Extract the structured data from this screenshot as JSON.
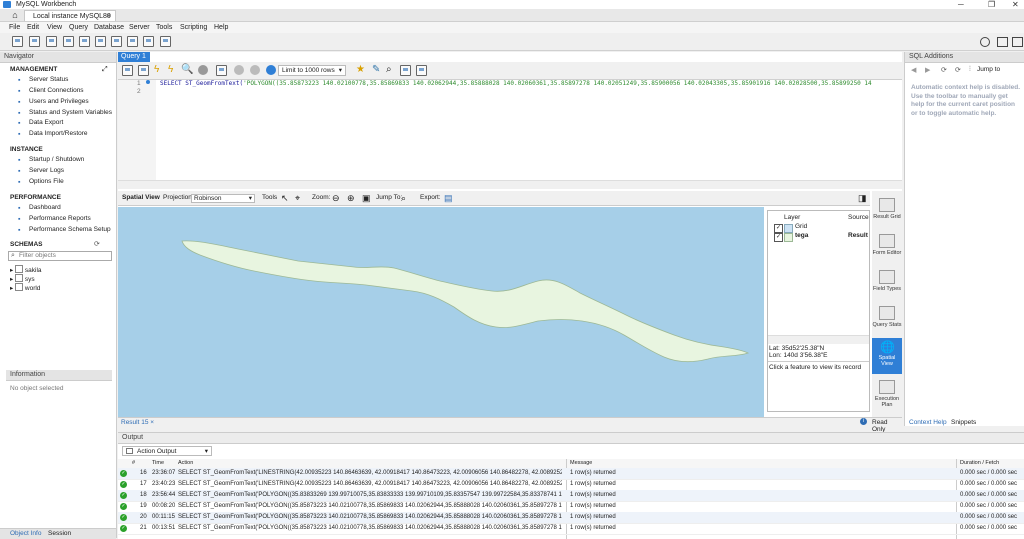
{
  "window": {
    "title": "MySQL Workbench",
    "connection_tab": "Local instance MySQL80"
  },
  "menu": [
    "File",
    "Edit",
    "View",
    "Query",
    "Database",
    "Server",
    "Tools",
    "Scripting",
    "Help"
  ],
  "navigator": {
    "header": "Navigator",
    "management": {
      "title": "MANAGEMENT",
      "items": [
        "Server Status",
        "Client Connections",
        "Users and Privileges",
        "Status and System Variables",
        "Data Export",
        "Data Import/Restore"
      ]
    },
    "instance": {
      "title": "INSTANCE",
      "items": [
        "Startup / Shutdown",
        "Server Logs",
        "Options File"
      ]
    },
    "performance": {
      "title": "PERFORMANCE",
      "items": [
        "Dashboard",
        "Performance Reports",
        "Performance Schema Setup"
      ]
    },
    "schemas": {
      "title": "SCHEMAS",
      "filter_placeholder": "Filter objects",
      "items": [
        "sakila",
        "sys",
        "world"
      ]
    }
  },
  "information": {
    "header": "Information",
    "empty": "No object selected"
  },
  "bottom_tabs": [
    "Object Info",
    "Session"
  ],
  "query": {
    "tab": "Query 1",
    "limit": "Limit to 1000 rows",
    "line_numbers": [
      "1",
      "2"
    ],
    "sql_kw": "SELECT ST_GeomFromText(",
    "sql_str": "'POLYGON((35.85873223 140.02100778,35.85869833 140.02062944,35.85888028 140.02060361,35.85897278 140.02051249,35.85900056 140.02043305,35.85901916 140.02028500,35.85899250 14"
  },
  "spatial": {
    "title": "Spatial View",
    "projection_label": "Projection:",
    "projection": "Robinson",
    "tools": "Tools",
    "zoom": "Zoom:",
    "jump": "Jump To:",
    "export": "Export:",
    "layers": {
      "col_layer": "Layer",
      "col_source": "Source",
      "rows": [
        {
          "name": "Grid",
          "source": ""
        },
        {
          "name": "tega",
          "source": "Result 1"
        }
      ]
    },
    "lat": "Lat:   35d52'25.38\"N",
    "lon": "Lon:  140d 3'56.38\"E",
    "hint": "Click a feature to view its record"
  },
  "side_buttons": [
    "Result Grid",
    "Form Editor",
    "Field Types",
    "Query Stats",
    "Spatial View",
    "Execution Plan"
  ],
  "result_bar": {
    "tab": "Result 15",
    "read_only": "Read Only"
  },
  "sql_additions": {
    "header": "SQL Additions",
    "jump": "Jump to",
    "help": [
      "Automatic context help is disabled.",
      "Use the toolbar to manually get",
      "help for the current caret position",
      "or to toggle automatic help."
    ],
    "tabs": [
      "Context Help",
      "Snippets"
    ]
  },
  "output": {
    "header": "Output",
    "selector": "Action Output",
    "columns": [
      "#",
      "Time",
      "Action",
      "Message",
      "Duration / Fetch"
    ],
    "rows": [
      {
        "n": "16",
        "time": "23:36:07",
        "action": "SELECT ST_GeomFromText('LINESTRING(42.00935223 140.86463639, 42.00918417 140.86473223, 42.00906056 140.86482278, 42.00892528 14...",
        "msg": "1 row(s) returned",
        "dur": "0.000 sec / 0.000 sec"
      },
      {
        "n": "17",
        "time": "23:40:23",
        "action": "SELECT ST_GeomFromText('LINESTRING(42.00935223 140.86463639, 42.00918417 140.86473223, 42.00906056 140.86482278, 42.00892528 14...",
        "msg": "1 row(s) returned",
        "dur": "0.000 sec / 0.000 sec"
      },
      {
        "n": "18",
        "time": "23:56:44",
        "action": "SELECT ST_GeomFromText('POLYGON((35.83833269 139.99710075,35.83833333 139.99710109,35.83357547 139.99722584,35.83378741 139.99...",
        "msg": "1 row(s) returned",
        "dur": "0.000 sec / 0.000 sec"
      },
      {
        "n": "19",
        "time": "00:08:20",
        "action": "SELECT ST_GeomFromText('POLYGON((35.85873223 140.02100778,35.85869833 140.02062944,35.85888028 140.02060361,35.85897278 140.0...",
        "msg": "1 row(s) returned",
        "dur": "0.000 sec / 0.000 sec"
      },
      {
        "n": "20",
        "time": "00:11:15",
        "action": "SELECT ST_GeomFromText('POLYGON((35.85873223 140.02100778,35.85869833 140.02062944,35.85888028 140.02060361,35.85897278 140.0...",
        "msg": "1 row(s) returned",
        "dur": "0.000 sec / 0.000 sec"
      },
      {
        "n": "21",
        "time": "00:13:51",
        "action": "SELECT ST_GeomFromText('POLYGON((35.85873223 140.02100778,35.85869833 140.02062944,35.85888028 140.02060361,35.85897278 140.0...",
        "msg": "1 row(s) returned",
        "dur": "0.000 sec / 0.000 sec"
      }
    ]
  }
}
